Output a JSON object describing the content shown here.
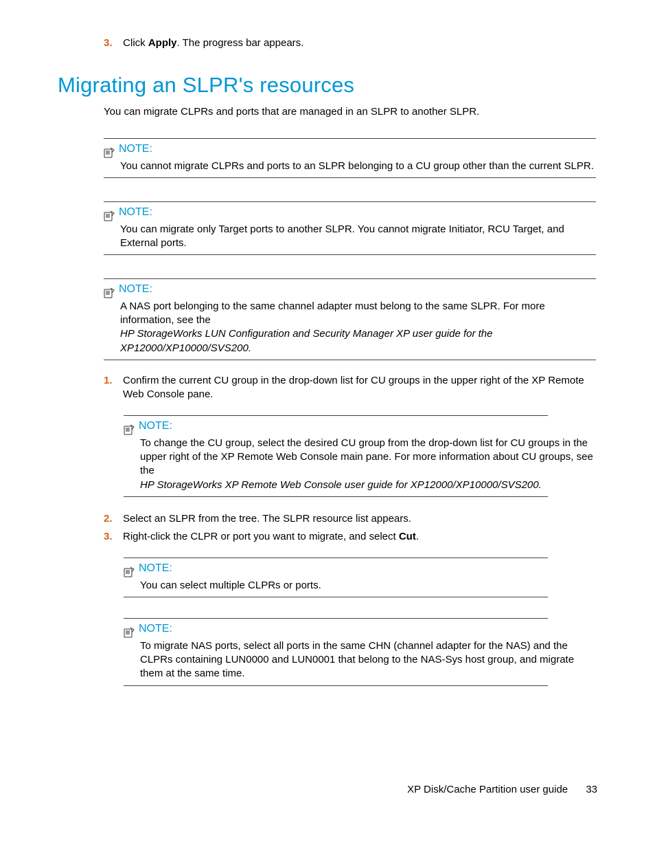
{
  "top_step": {
    "num": "3.",
    "text_before": "Click ",
    "bold": "Apply",
    "text_after": ". The progress bar appears."
  },
  "heading": "Migrating an SLPR's resources",
  "intro": "You can migrate CLPRs and ports that are managed in an SLPR to another SLPR.",
  "note_label": "NOTE:",
  "notes_top": [
    {
      "body": "You cannot migrate CLPRs and ports to an SLPR belonging to a CU group other than the current SLPR."
    },
    {
      "body": "You can migrate only Target ports to another SLPR. You cannot migrate Initiator, RCU Target, and External ports."
    },
    {
      "body_line1": "A NAS port belonging to the same channel adapter must belong to the same SLPR. For more information, see the",
      "body_line2_italic": "HP StorageWorks LUN Configuration and Security Manager XP user guide for the XP12000/XP10000/SVS200."
    }
  ],
  "steps": [
    {
      "num": "1.",
      "text": "Confirm the current CU group in the drop-down list for CU groups in the upper right of the XP Remote Web Console pane."
    },
    {
      "num": "2.",
      "text": "Select an SLPR from the tree. The SLPR resource list appears."
    },
    {
      "num": "3.",
      "text_before": "Right-click the CLPR or port you want to migrate, and select ",
      "bold": "Cut",
      "text_after": "."
    }
  ],
  "note_inner_1": {
    "body_a": "To change the CU group, select the desired CU group from the drop-down list for CU groups in the upper right of the XP Remote Web Console main pane. For more information about CU groups, see the",
    "body_b_italic": "HP StorageWorks XP Remote Web Console user guide for XP12000/XP10000/SVS200."
  },
  "note_inner_2": {
    "body": "You can select multiple CLPRs or ports."
  },
  "note_inner_3": {
    "body": "To migrate NAS ports, select all ports in the same CHN (channel adapter for the NAS) and the CLPRs containing LUN0000 and LUN0001 that belong to the NAS-Sys host group, and migrate them at the same time."
  },
  "footer": {
    "title": "XP Disk/Cache Partition user guide",
    "page": "33"
  }
}
